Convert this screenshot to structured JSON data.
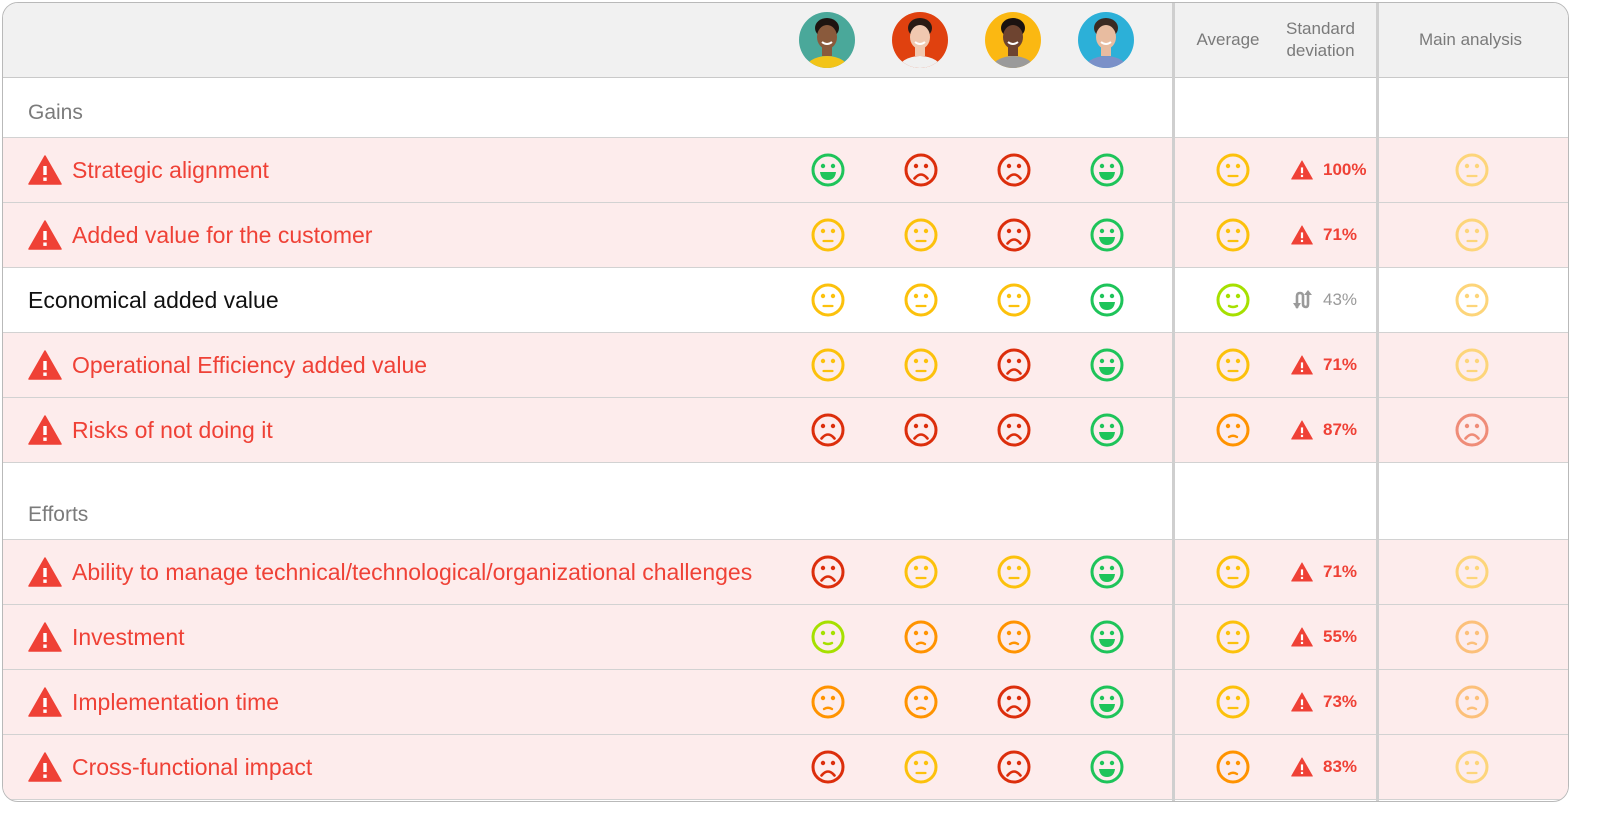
{
  "header": {
    "evaluators": [
      {
        "name": "evaluator-1",
        "bg": "#4aa89a",
        "shirt": "#f2c418",
        "skin": "#8a5a3c",
        "hair": "#1e1410"
      },
      {
        "name": "evaluator-2",
        "bg": "#e0410f",
        "shirt": "#f0f0f0",
        "skin": "#f0c8b0",
        "hair": "#2a1a14"
      },
      {
        "name": "evaluator-3",
        "bg": "#fbb812",
        "shirt": "#9a9a9a",
        "skin": "#6e4430",
        "hair": "#1a1210"
      },
      {
        "name": "evaluator-4",
        "bg": "#2cb0d8",
        "shirt": "#7a90c8",
        "skin": "#e8bca0",
        "hair": "#3a2a22"
      }
    ],
    "average_label": "Average",
    "stddev_label_1": "Standard",
    "stddev_label_2": "deviation",
    "main_analysis_label": "Main analysis"
  },
  "colors": {
    "green": "#1ec45a",
    "lime": "#a6e000",
    "yellow": "#fcc10c",
    "orange": "#ff9300",
    "red": "#dc2e0c",
    "alert": "#ef4136",
    "muted_yellow": "#fdd57a",
    "muted_orange": "#fcc07a",
    "muted_red": "#ef8c78"
  },
  "sections": [
    {
      "label": "Gains",
      "rows": [
        {
          "label": "Strategic alignment",
          "alert": true,
          "ratings": [
            "very-good",
            "very-bad",
            "very-bad",
            "very-good"
          ],
          "average": "neutral",
          "stddev": "100%",
          "stddev_icon": "warning",
          "main": "neutral-muted"
        },
        {
          "label": "Added value for the customer",
          "alert": true,
          "ratings": [
            "neutral",
            "neutral",
            "very-bad",
            "very-good"
          ],
          "average": "neutral",
          "stddev": "71%",
          "stddev_icon": "warning",
          "main": "neutral-muted"
        },
        {
          "label": "Economical added value",
          "alert": false,
          "ratings": [
            "neutral",
            "neutral",
            "neutral",
            "very-good"
          ],
          "average": "good",
          "stddev": "43%",
          "stddev_icon": "swap",
          "main": "neutral-muted"
        },
        {
          "label": "Operational Efficiency added value",
          "alert": true,
          "ratings": [
            "neutral",
            "neutral",
            "very-bad",
            "very-good"
          ],
          "average": "neutral",
          "stddev": "71%",
          "stddev_icon": "warning",
          "main": "neutral-muted"
        },
        {
          "label": "Risks of not doing it",
          "alert": true,
          "ratings": [
            "very-bad",
            "very-bad",
            "very-bad",
            "very-good"
          ],
          "average": "bad",
          "stddev": "87%",
          "stddev_icon": "warning",
          "main": "very-bad-muted"
        }
      ]
    },
    {
      "label": "Efforts",
      "rows": [
        {
          "label": "Ability to manage technical/technological/organizational challenges",
          "alert": true,
          "ratings": [
            "very-bad",
            "neutral",
            "neutral",
            "very-good"
          ],
          "average": "neutral",
          "stddev": "71%",
          "stddev_icon": "warning",
          "main": "neutral-muted"
        },
        {
          "label": "Investment",
          "alert": true,
          "ratings": [
            "good",
            "bad",
            "bad",
            "very-good"
          ],
          "average": "neutral",
          "stddev": "55%",
          "stddev_icon": "warning",
          "main": "bad-muted"
        },
        {
          "label": "Implementation time",
          "alert": true,
          "ratings": [
            "bad",
            "bad",
            "very-bad",
            "very-good"
          ],
          "average": "neutral",
          "stddev": "73%",
          "stddev_icon": "warning",
          "main": "bad-muted"
        },
        {
          "label": "Cross-functional impact",
          "alert": true,
          "ratings": [
            "very-bad",
            "neutral",
            "very-bad",
            "very-good"
          ],
          "average": "bad",
          "stddev": "83%",
          "stddev_icon": "warning",
          "main": "neutral-muted"
        }
      ]
    }
  ]
}
